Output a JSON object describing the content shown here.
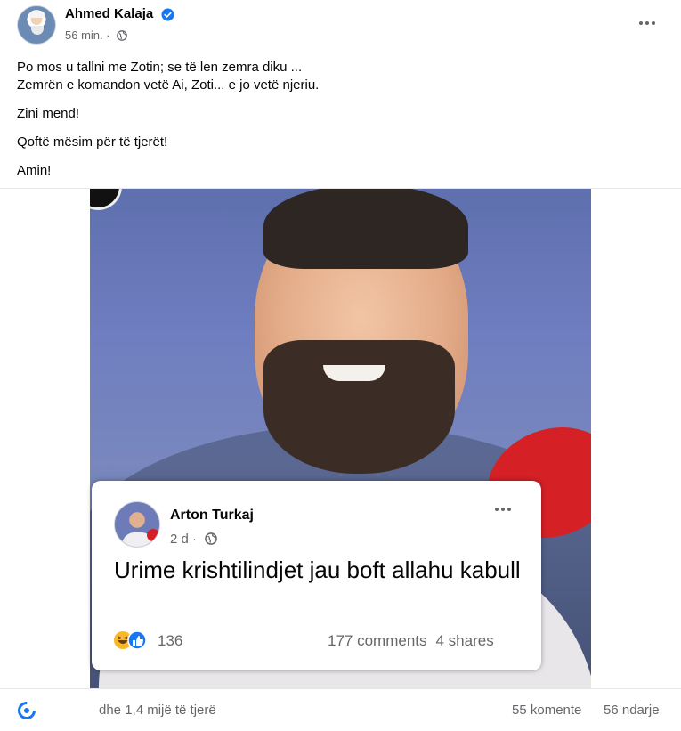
{
  "post": {
    "author": "Ahmed Kalaja",
    "time": "56 min. ·",
    "text": {
      "line1": "Po mos u tallni me Zotin; se të len zemra diku ...",
      "line2": "Zemrën e komandon vetë Ai,  Zoti... e jo vetë njeriu.",
      "line3": "Zini mend!",
      "line4": "Qoftë mësim për të tjerët!",
      "line5": "Amin!"
    }
  },
  "embedded_card": {
    "author": "Arton Turkaj",
    "time": "2 d ·",
    "text": "Urime krishtilindjet jau boft allahu kabull",
    "reaction_count": "136",
    "comments": "177 comments",
    "shares": "4 shares"
  },
  "footer": {
    "others": "dhe 1,4 mijë të tjerë",
    "comments": "55 komente",
    "shares": "56 ndarje"
  },
  "colors": {
    "verified": "#1877f2",
    "secondary_text": "#65676b",
    "like_blue": "#1877f2",
    "haha_yellow": "#f7b928"
  },
  "icons": [
    "verified-badge-icon",
    "globe-icon",
    "more-options-icon",
    "haha-reaction-icon",
    "like-reaction-icon",
    "reactions-icon"
  ]
}
